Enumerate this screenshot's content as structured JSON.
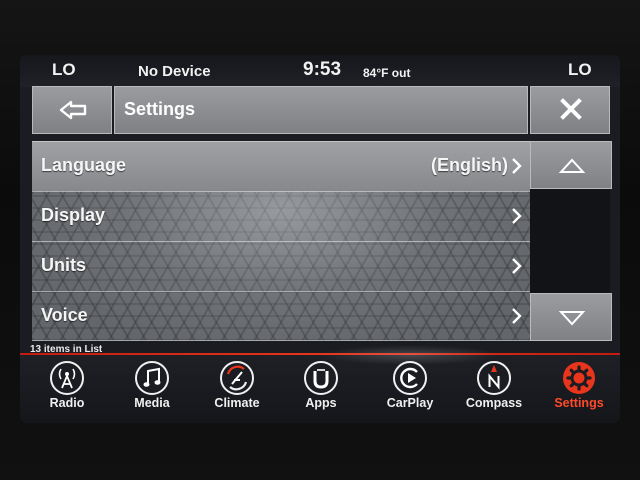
{
  "status_bar": {
    "left_temp": "LO",
    "source": "No Device",
    "time": "9:53",
    "outside_temp": "84°F out",
    "right_temp": "LO"
  },
  "header": {
    "back_icon": "back-arrow-icon",
    "title": "Settings",
    "close_icon": "close-x-icon"
  },
  "list": {
    "items": [
      {
        "label": "Language",
        "value": "(English)",
        "icon": "chevron-right-icon"
      },
      {
        "label": "Display",
        "value": "",
        "icon": "chevron-right-icon"
      },
      {
        "label": "Units",
        "value": "",
        "icon": "chevron-right-icon"
      },
      {
        "label": "Voice",
        "value": "",
        "icon": "chevron-right-icon"
      }
    ],
    "count_text": "13 items in List",
    "scroll_up_icon": "triangle-up-icon",
    "scroll_down_icon": "triangle-down-icon"
  },
  "nav": {
    "items": [
      {
        "label": "Radio",
        "icon": "radio-tower-icon"
      },
      {
        "label": "Media",
        "icon": "music-note-icon"
      },
      {
        "label": "Climate",
        "icon": "climate-fan-icon"
      },
      {
        "label": "Apps",
        "icon": "apps-u-icon"
      },
      {
        "label": "CarPlay",
        "icon": "carplay-icon"
      },
      {
        "label": "Compass",
        "icon": "compass-icon"
      },
      {
        "label": "Settings",
        "icon": "gear-icon",
        "active": true
      }
    ]
  },
  "colors": {
    "accent_red": "#e8351c",
    "active_label": "#ff4a2a",
    "button_gray": "#8c8e92"
  }
}
